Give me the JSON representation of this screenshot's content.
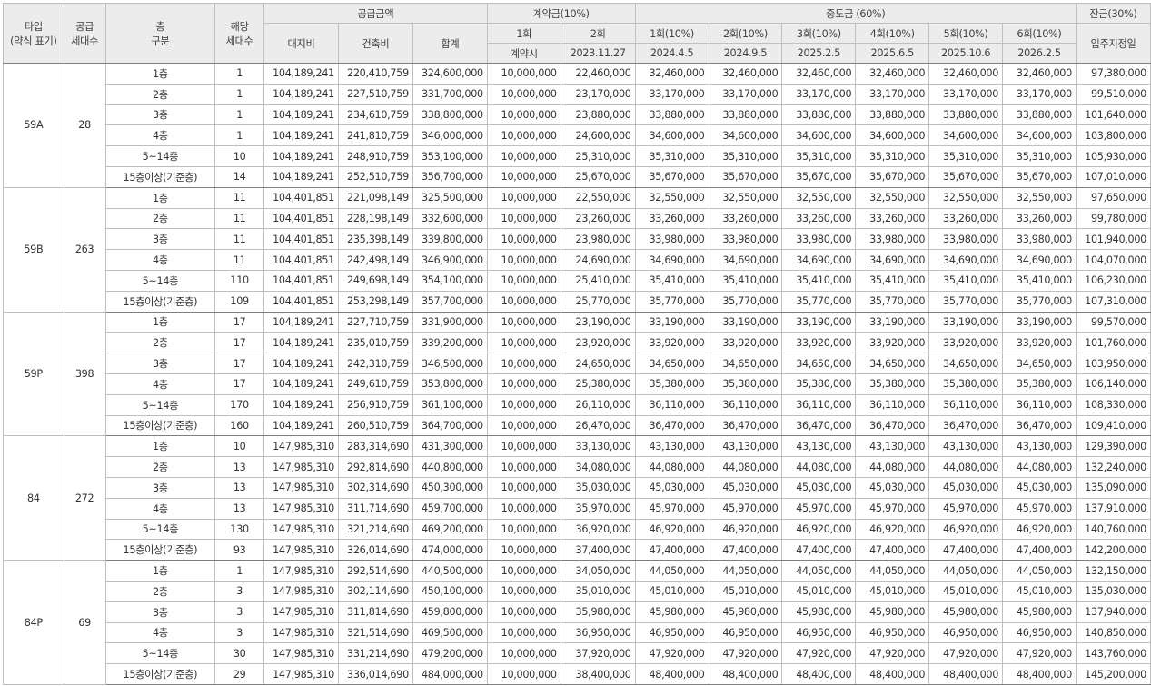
{
  "headers": {
    "type": "타입\n(약식 표기)",
    "supply_units": "공급\n세대수",
    "floor_group": "층\n구분",
    "units": "해당\n세대수",
    "supply_price": "공급금액",
    "land": "대지비",
    "building": "건축비",
    "total": "합계",
    "contract": "계약금(10%)",
    "contract_1": "1회",
    "contract_2": "2회",
    "contract_1_date": "계약시",
    "contract_2_date": "2023.11.27",
    "middle": "중도금 (60%)",
    "middle_installments": [
      {
        "label": "1회(10%)",
        "date": "2024.4.5"
      },
      {
        "label": "2회(10%)",
        "date": "2024.9.5"
      },
      {
        "label": "3회(10%)",
        "date": "2025.2.5"
      },
      {
        "label": "4회(10%)",
        "date": "2025.6.5"
      },
      {
        "label": "5회(10%)",
        "date": "2025.10.6"
      },
      {
        "label": "6회(10%)",
        "date": "2026.2.5"
      }
    ],
    "balance": "잔금(30%)",
    "balance_date": "입주지정일"
  },
  "groups": [
    {
      "type": "59A",
      "supply": "28",
      "rows": [
        [
          "1층",
          "1",
          "104,189,241",
          "220,410,759",
          "324,600,000",
          "10,000,000",
          "22,460,000",
          "32,460,000",
          "32,460,000",
          "32,460,000",
          "32,460,000",
          "32,460,000",
          "32,460,000",
          "97,380,000"
        ],
        [
          "2층",
          "1",
          "104,189,241",
          "227,510,759",
          "331,700,000",
          "10,000,000",
          "23,170,000",
          "33,170,000",
          "33,170,000",
          "33,170,000",
          "33,170,000",
          "33,170,000",
          "33,170,000",
          "99,510,000"
        ],
        [
          "3층",
          "1",
          "104,189,241",
          "234,610,759",
          "338,800,000",
          "10,000,000",
          "23,880,000",
          "33,880,000",
          "33,880,000",
          "33,880,000",
          "33,880,000",
          "33,880,000",
          "33,880,000",
          "101,640,000"
        ],
        [
          "4층",
          "1",
          "104,189,241",
          "241,810,759",
          "346,000,000",
          "10,000,000",
          "24,600,000",
          "34,600,000",
          "34,600,000",
          "34,600,000",
          "34,600,000",
          "34,600,000",
          "34,600,000",
          "103,800,000"
        ],
        [
          "5~14층",
          "10",
          "104,189,241",
          "248,910,759",
          "353,100,000",
          "10,000,000",
          "25,310,000",
          "35,310,000",
          "35,310,000",
          "35,310,000",
          "35,310,000",
          "35,310,000",
          "35,310,000",
          "105,930,000"
        ],
        [
          "15층이상(기준층)",
          "14",
          "104,189,241",
          "252,510,759",
          "356,700,000",
          "10,000,000",
          "25,670,000",
          "35,670,000",
          "35,670,000",
          "35,670,000",
          "35,670,000",
          "35,670,000",
          "35,670,000",
          "107,010,000"
        ]
      ]
    },
    {
      "type": "59B",
      "supply": "263",
      "rows": [
        [
          "1층",
          "11",
          "104,401,851",
          "221,098,149",
          "325,500,000",
          "10,000,000",
          "22,550,000",
          "32,550,000",
          "32,550,000",
          "32,550,000",
          "32,550,000",
          "32,550,000",
          "32,550,000",
          "97,650,000"
        ],
        [
          "2층",
          "11",
          "104,401,851",
          "228,198,149",
          "332,600,000",
          "10,000,000",
          "23,260,000",
          "33,260,000",
          "33,260,000",
          "33,260,000",
          "33,260,000",
          "33,260,000",
          "33,260,000",
          "99,780,000"
        ],
        [
          "3층",
          "11",
          "104,401,851",
          "235,398,149",
          "339,800,000",
          "10,000,000",
          "23,980,000",
          "33,980,000",
          "33,980,000",
          "33,980,000",
          "33,980,000",
          "33,980,000",
          "33,980,000",
          "101,940,000"
        ],
        [
          "4층",
          "11",
          "104,401,851",
          "242,498,149",
          "346,900,000",
          "10,000,000",
          "24,690,000",
          "34,690,000",
          "34,690,000",
          "34,690,000",
          "34,690,000",
          "34,690,000",
          "34,690,000",
          "104,070,000"
        ],
        [
          "5~14층",
          "110",
          "104,401,851",
          "249,698,149",
          "354,100,000",
          "10,000,000",
          "25,410,000",
          "35,410,000",
          "35,410,000",
          "35,410,000",
          "35,410,000",
          "35,410,000",
          "35,410,000",
          "106,230,000"
        ],
        [
          "15층이상(기준층)",
          "109",
          "104,401,851",
          "253,298,149",
          "357,700,000",
          "10,000,000",
          "25,770,000",
          "35,770,000",
          "35,770,000",
          "35,770,000",
          "35,770,000",
          "35,770,000",
          "35,770,000",
          "107,310,000"
        ]
      ]
    },
    {
      "type": "59P",
      "supply": "398",
      "rows": [
        [
          "1층",
          "17",
          "104,189,241",
          "227,710,759",
          "331,900,000",
          "10,000,000",
          "23,190,000",
          "33,190,000",
          "33,190,000",
          "33,190,000",
          "33,190,000",
          "33,190,000",
          "33,190,000",
          "99,570,000"
        ],
        [
          "2층",
          "17",
          "104,189,241",
          "235,010,759",
          "339,200,000",
          "10,000,000",
          "23,920,000",
          "33,920,000",
          "33,920,000",
          "33,920,000",
          "33,920,000",
          "33,920,000",
          "33,920,000",
          "101,760,000"
        ],
        [
          "3층",
          "17",
          "104,189,241",
          "242,310,759",
          "346,500,000",
          "10,000,000",
          "24,650,000",
          "34,650,000",
          "34,650,000",
          "34,650,000",
          "34,650,000",
          "34,650,000",
          "34,650,000",
          "103,950,000"
        ],
        [
          "4층",
          "17",
          "104,189,241",
          "249,610,759",
          "353,800,000",
          "10,000,000",
          "25,380,000",
          "35,380,000",
          "35,380,000",
          "35,380,000",
          "35,380,000",
          "35,380,000",
          "35,380,000",
          "106,140,000"
        ],
        [
          "5~14층",
          "170",
          "104,189,241",
          "256,910,759",
          "361,100,000",
          "10,000,000",
          "26,110,000",
          "36,110,000",
          "36,110,000",
          "36,110,000",
          "36,110,000",
          "36,110,000",
          "36,110,000",
          "108,330,000"
        ],
        [
          "15층이상(기준층)",
          "160",
          "104,189,241",
          "260,510,759",
          "364,700,000",
          "10,000,000",
          "26,470,000",
          "36,470,000",
          "36,470,000",
          "36,470,000",
          "36,470,000",
          "36,470,000",
          "36,470,000",
          "109,410,000"
        ]
      ]
    },
    {
      "type": "84",
      "supply": "272",
      "rows": [
        [
          "1층",
          "10",
          "147,985,310",
          "283,314,690",
          "431,300,000",
          "10,000,000",
          "33,130,000",
          "43,130,000",
          "43,130,000",
          "43,130,000",
          "43,130,000",
          "43,130,000",
          "43,130,000",
          "129,390,000"
        ],
        [
          "2층",
          "13",
          "147,985,310",
          "292,814,690",
          "440,800,000",
          "10,000,000",
          "34,080,000",
          "44,080,000",
          "44,080,000",
          "44,080,000",
          "44,080,000",
          "44,080,000",
          "44,080,000",
          "132,240,000"
        ],
        [
          "3층",
          "13",
          "147,985,310",
          "302,314,690",
          "450,300,000",
          "10,000,000",
          "35,030,000",
          "45,030,000",
          "45,030,000",
          "45,030,000",
          "45,030,000",
          "45,030,000",
          "45,030,000",
          "135,090,000"
        ],
        [
          "4층",
          "13",
          "147,985,310",
          "311,714,690",
          "459,700,000",
          "10,000,000",
          "35,970,000",
          "45,970,000",
          "45,970,000",
          "45,970,000",
          "45,970,000",
          "45,970,000",
          "45,970,000",
          "137,910,000"
        ],
        [
          "5~14층",
          "130",
          "147,985,310",
          "321,214,690",
          "469,200,000",
          "10,000,000",
          "36,920,000",
          "46,920,000",
          "46,920,000",
          "46,920,000",
          "46,920,000",
          "46,920,000",
          "46,920,000",
          "140,760,000"
        ],
        [
          "15층이상(기준층)",
          "93",
          "147,985,310",
          "326,014,690",
          "474,000,000",
          "10,000,000",
          "37,400,000",
          "47,400,000",
          "47,400,000",
          "47,400,000",
          "47,400,000",
          "47,400,000",
          "47,400,000",
          "142,200,000"
        ]
      ]
    },
    {
      "type": "84P",
      "supply": "69",
      "rows": [
        [
          "1층",
          "1",
          "147,985,310",
          "292,514,690",
          "440,500,000",
          "10,000,000",
          "34,050,000",
          "44,050,000",
          "44,050,000",
          "44,050,000",
          "44,050,000",
          "44,050,000",
          "44,050,000",
          "132,150,000"
        ],
        [
          "2층",
          "3",
          "147,985,310",
          "302,114,690",
          "450,100,000",
          "10,000,000",
          "35,010,000",
          "45,010,000",
          "45,010,000",
          "45,010,000",
          "45,010,000",
          "45,010,000",
          "45,010,000",
          "135,030,000"
        ],
        [
          "3층",
          "3",
          "147,985,310",
          "311,814,690",
          "459,800,000",
          "10,000,000",
          "35,980,000",
          "45,980,000",
          "45,980,000",
          "45,980,000",
          "45,980,000",
          "45,980,000",
          "45,980,000",
          "137,940,000"
        ],
        [
          "4층",
          "3",
          "147,985,310",
          "321,514,690",
          "469,500,000",
          "10,000,000",
          "36,950,000",
          "46,950,000",
          "46,950,000",
          "46,950,000",
          "46,950,000",
          "46,950,000",
          "46,950,000",
          "140,850,000"
        ],
        [
          "5~14층",
          "30",
          "147,985,310",
          "331,214,690",
          "479,200,000",
          "10,000,000",
          "37,920,000",
          "47,920,000",
          "47,920,000",
          "47,920,000",
          "47,920,000",
          "47,920,000",
          "47,920,000",
          "143,760,000"
        ],
        [
          "15층이상(기준층)",
          "29",
          "147,985,310",
          "336,014,690",
          "484,000,000",
          "10,000,000",
          "38,400,000",
          "48,400,000",
          "48,400,000",
          "48,400,000",
          "48,400,000",
          "48,400,000",
          "48,400,000",
          "145,200,000"
        ]
      ]
    }
  ]
}
